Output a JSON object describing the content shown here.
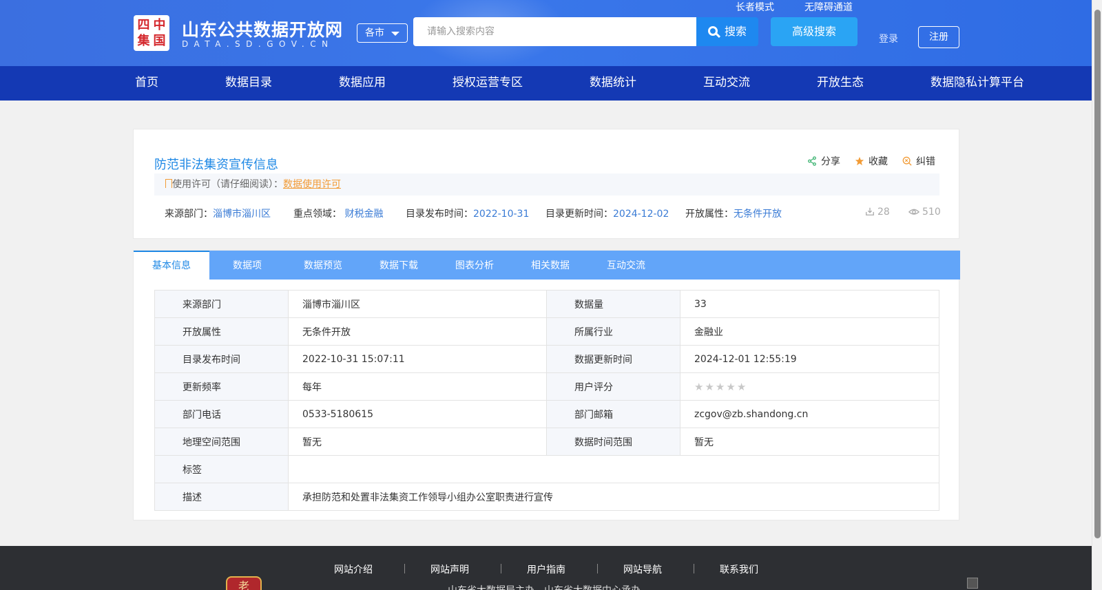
{
  "header": {
    "logo_seal_chars": [
      "四",
      "中",
      "集",
      "国"
    ],
    "logo_title": "山东公共数据开放网",
    "logo_sub": "DATA.SD.GOV.CN",
    "city_select": "各市",
    "search_placeholder": "请输入搜索内容",
    "search_label": "搜索",
    "advanced_search_label": "高级搜索",
    "elder_mode": "长者模式",
    "accessibility": "无障碍通道",
    "login": "登录",
    "register": "注册"
  },
  "nav": [
    "首页",
    "数据目录",
    "数据应用",
    "授权运营专区",
    "数据统计",
    "互动交流",
    "开放生态",
    "数据隐私计算平台"
  ],
  "dataset": {
    "title": "防范非法集资宣传信息",
    "actions": {
      "share": "分享",
      "favorite": "收藏",
      "report": "纠错"
    },
    "license_prefix": "使用许可（请仔细阅读）：",
    "license_link": "数据使用许可",
    "meta": [
      {
        "label": "来源部门：",
        "value": "淄博市淄川区"
      },
      {
        "label": "重点领域：",
        "value": "财税金融"
      },
      {
        "label": "目录发布时间：",
        "value": "2022-10-31"
      },
      {
        "label": "目录更新时间：",
        "value": "2024-12-02"
      },
      {
        "label": "开放属性：",
        "value": "无条件开放"
      }
    ],
    "downloads": "28",
    "views": "510"
  },
  "tabs": [
    "基本信息",
    "数据项",
    "数据预览",
    "数据下载",
    "图表分析",
    "相关数据",
    "互动交流"
  ],
  "info": {
    "source_dept": {
      "k": "来源部门",
      "v": "淄博市淄川区"
    },
    "data_amount": {
      "k": "数据量",
      "v": "33"
    },
    "open_attr": {
      "k": "开放属性",
      "v": "无条件开放"
    },
    "industry": {
      "k": "所属行业",
      "v": "金融业"
    },
    "publish_time": {
      "k": "目录发布时间",
      "v": "2022-10-31 15:07:11"
    },
    "update_time": {
      "k": "数据更新时间",
      "v": "2024-12-01 12:55:19"
    },
    "frequency": {
      "k": "更新频率",
      "v": "每年"
    },
    "rating": {
      "k": "用户评分",
      "stars": 0,
      "max": 5
    },
    "phone": {
      "k": "部门电话",
      "v": "0533-5180615"
    },
    "email": {
      "k": "部门邮箱",
      "v": "zcgov@zb.shandong.cn"
    },
    "geo_range": {
      "k": "地理空间范围",
      "v": "暂无"
    },
    "time_range": {
      "k": "数据时间范围",
      "v": "暂无"
    },
    "tags": {
      "k": "标签",
      "v": ""
    },
    "description": {
      "k": "描述",
      "v": "承担防范和处置非法集资工作领导小组办公室职责进行宣传"
    }
  },
  "footer": {
    "links": [
      "网站介绍",
      "网站声明",
      "用户指南",
      "网站导航",
      "联系我们"
    ],
    "badge_char": "老",
    "note": "山东省大数据局主办　山东省大数据中心承办"
  },
  "colors": {
    "nav_bg": "#1439b4",
    "tab_bg": "#62a5f9",
    "link_blue": "#1e88e5",
    "license_orange": "#f29b35"
  }
}
